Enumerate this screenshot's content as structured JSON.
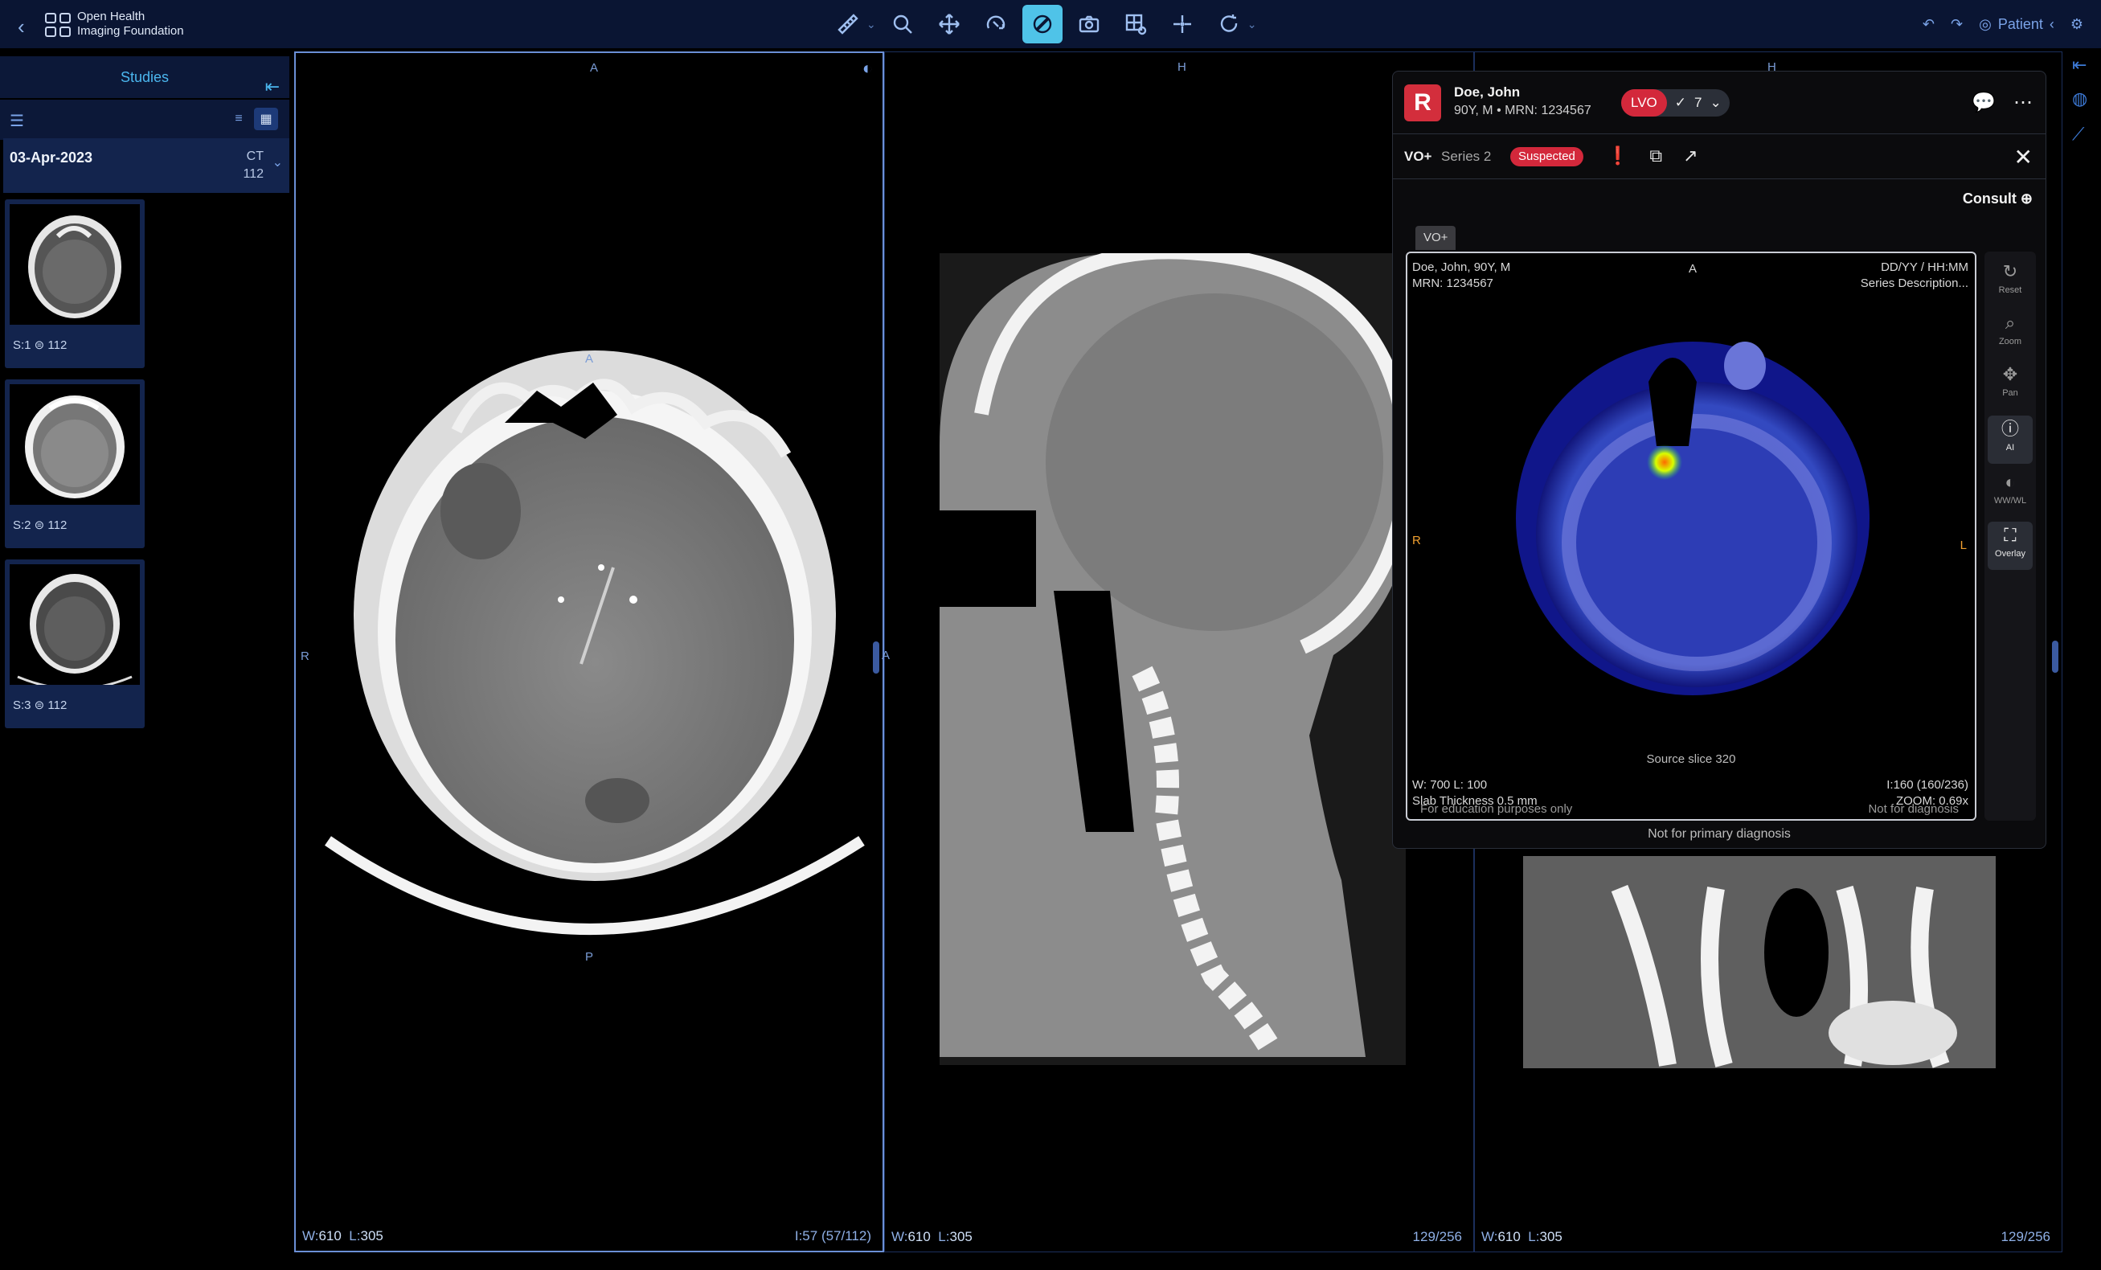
{
  "topbar": {
    "org_line1": "Open Health",
    "org_line2": "Imaging Foundation",
    "patient_label": "Patient"
  },
  "left_panel": {
    "title": "Studies",
    "study": {
      "date": "03-Apr-2023",
      "modality": "CT",
      "count": "112"
    },
    "thumbnails": [
      {
        "series": "S:1",
        "count": "112"
      },
      {
        "series": "S:2",
        "count": "112"
      },
      {
        "series": "S:3",
        "count": "112"
      }
    ]
  },
  "viewports": [
    {
      "top": "A",
      "left": "R",
      "bottom_marker": "P",
      "top_marker": "A",
      "w_label": "W:",
      "w": "610",
      "l_label": "L:",
      "l": "305",
      "slice": "I:57 (57/112)"
    },
    {
      "top": "H",
      "left": "A",
      "w_label": "W:",
      "w": "610",
      "l_label": "L:",
      "l": "305",
      "slice": "129/256"
    },
    {
      "top": "H",
      "w_label": "W:",
      "w": "610",
      "l_label": "L:",
      "l": "305",
      "slice": "129/256"
    }
  ],
  "popup": {
    "patient_name": "Doe, John",
    "patient_meta": "90Y, M • MRN: 1234567",
    "lvo_tag": "LVO",
    "lvo_count": "7",
    "vo_label": "VO+",
    "series_label": "Series 2",
    "status": "Suspected",
    "consult": "Consult",
    "tab_label": "VO+",
    "mini": {
      "patient_line1": "Doe, John, 90Y, M",
      "patient_line2": "MRN: 1234567",
      "top": "A",
      "date_line": "DD/YY / HH:MM",
      "series_desc": "Series Description...",
      "left": "R",
      "right": "L",
      "source_slice": "Source slice 320",
      "wl": "W: 700 L: 100",
      "slab": "Slab Thickness 0.5 mm",
      "edu": "For education purposes only",
      "index": "I:160 (160/236)",
      "zoom": "ZOOM: 0.69x",
      "not_diag": "Not for diagnosis"
    },
    "side_tools": [
      "Reset",
      "Zoom",
      "Pan",
      "AI",
      "WW/WL",
      "Overlay"
    ],
    "footer": "Not for primary diagnosis"
  }
}
